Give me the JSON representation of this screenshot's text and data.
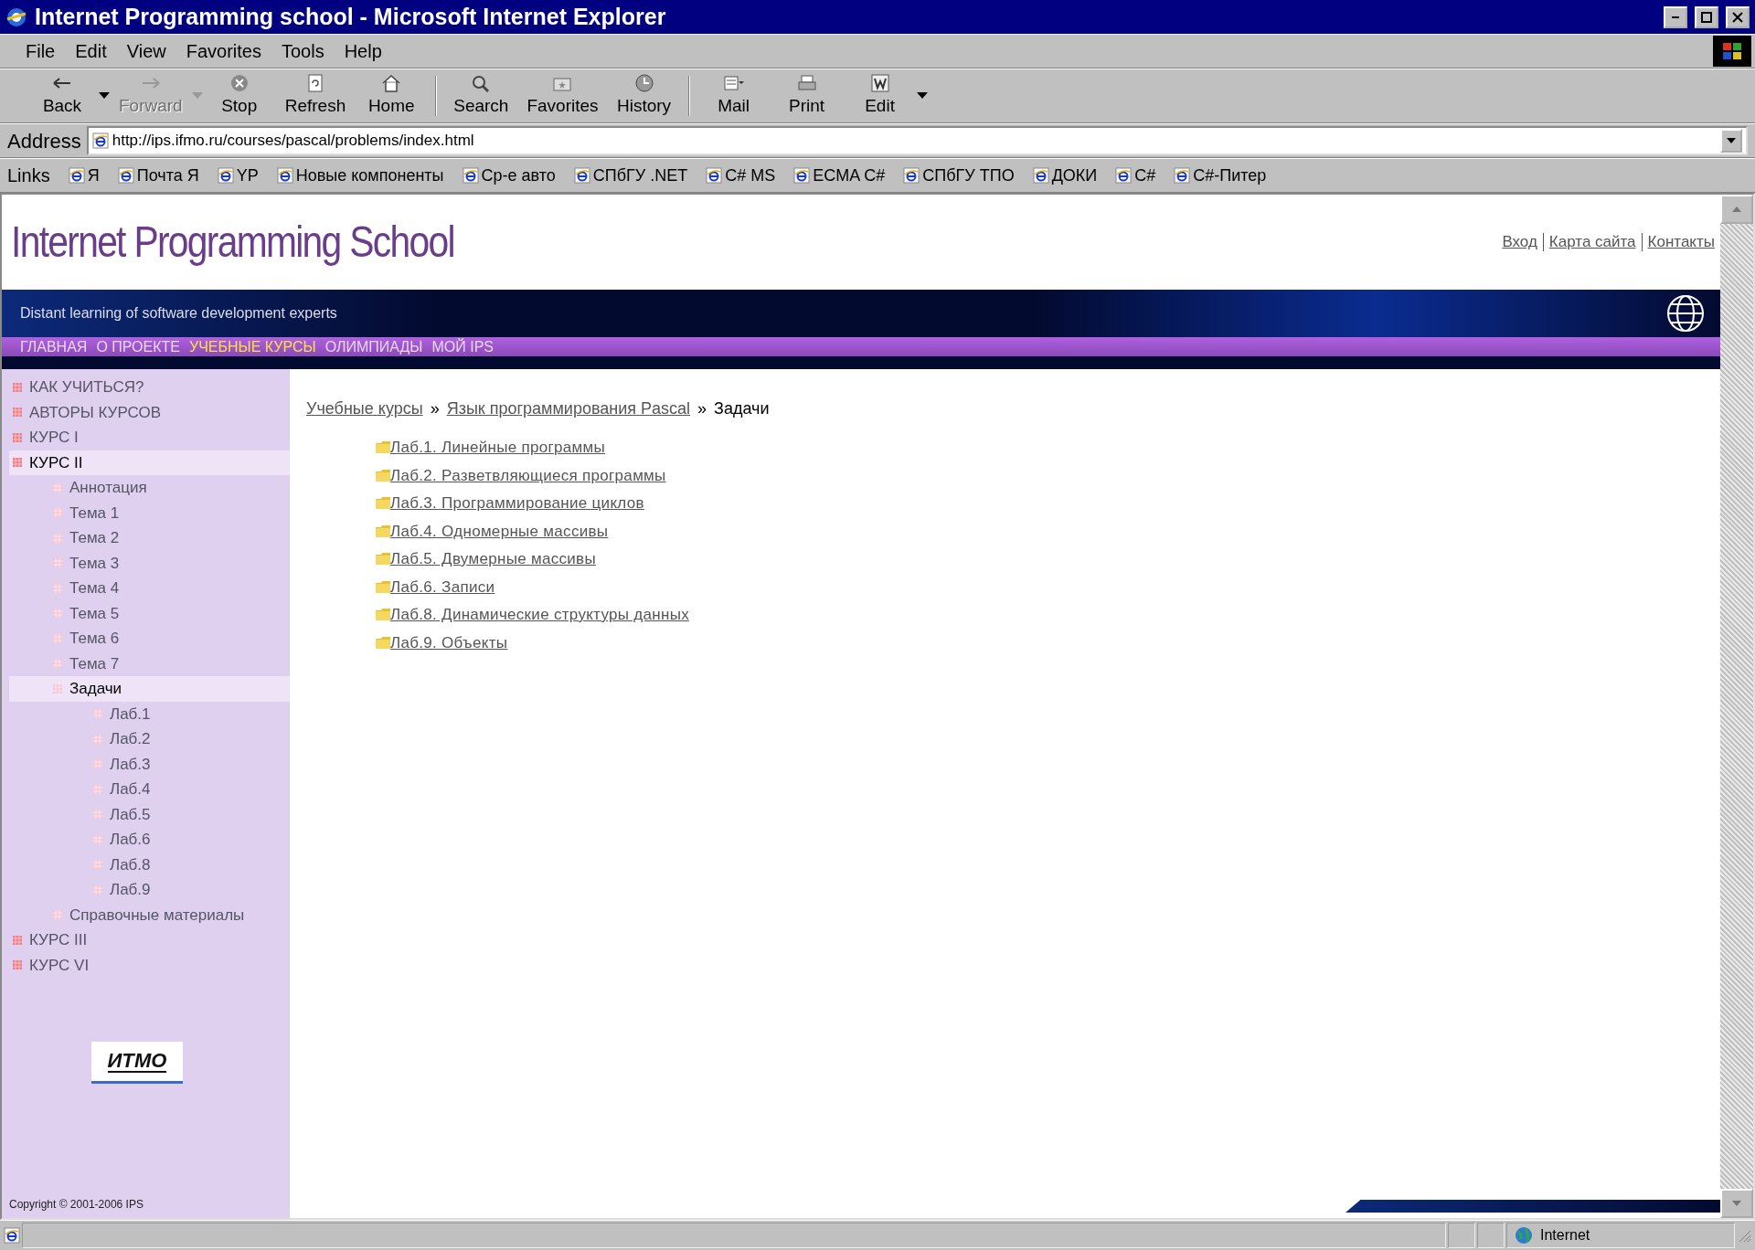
{
  "window": {
    "title": "Internet Programming school - Microsoft Internet Explorer"
  },
  "menu_bar": [
    "File",
    "Edit",
    "View",
    "Favorites",
    "Tools",
    "Help"
  ],
  "toolbar": [
    {
      "label": "Back",
      "kind": "back",
      "disabled": false,
      "dropdown": true
    },
    {
      "label": "Forward",
      "kind": "forward",
      "disabled": true,
      "dropdown": true
    },
    {
      "label": "Stop",
      "kind": "stop",
      "disabled": false,
      "dropdown": false
    },
    {
      "label": "Refresh",
      "kind": "refresh",
      "disabled": false,
      "dropdown": false
    },
    {
      "label": "Home",
      "kind": "home",
      "disabled": false,
      "dropdown": false
    },
    {
      "label": "Search",
      "kind": "search",
      "disabled": false,
      "dropdown": false
    },
    {
      "label": "Favorites",
      "kind": "favorites",
      "disabled": false,
      "dropdown": false
    },
    {
      "label": "History",
      "kind": "history",
      "disabled": false,
      "dropdown": false
    },
    {
      "label": "Mail",
      "kind": "mail",
      "disabled": false,
      "dropdown": false
    },
    {
      "label": "Print",
      "kind": "print",
      "disabled": false,
      "dropdown": false
    },
    {
      "label": "Edit",
      "kind": "edit",
      "disabled": false,
      "dropdown": false
    }
  ],
  "address_bar": {
    "label": "Address",
    "value": "http://ips.ifmo.ru/courses/pascal/problems/index.html"
  },
  "links_bar": {
    "label": "Links",
    "items": [
      "Я",
      "Почта Я",
      "YP",
      "Новые компоненты",
      "Ср-е авто",
      "СПбГУ .NET",
      "C# MS",
      "ECMA C#",
      "СПбГУ ТПО",
      "ДОКИ",
      "C#",
      "C#-Питер"
    ]
  },
  "page": {
    "site_title": "Internet Programming School",
    "header_links": [
      "Вход",
      "Карта сайта",
      "Контакты"
    ],
    "tagline": "Distant learning of software development experts",
    "nav": [
      {
        "label": "ГЛАВНАЯ",
        "selected": false
      },
      {
        "label": "О ПРОЕКТЕ",
        "selected": false
      },
      {
        "label": "УЧЕБНЫЕ КУРСЫ",
        "selected": true
      },
      {
        "label": "ОЛИМПИАДЫ",
        "selected": false
      },
      {
        "label": "МОЙ IPS",
        "selected": false
      }
    ],
    "sidebar": {
      "items": [
        {
          "label": "КАК УЧИТЬСЯ?",
          "selected": false
        },
        {
          "label": "АВТОРЫ КУРСОВ",
          "selected": false
        },
        {
          "label": "КУРС I",
          "selected": false
        },
        {
          "label": "КУРС II",
          "selected": true,
          "children": [
            {
              "label": "Аннотация",
              "selected": false
            },
            {
              "label": "Тема 1",
              "selected": false
            },
            {
              "label": "Тема 2",
              "selected": false
            },
            {
              "label": "Тема 3",
              "selected": false
            },
            {
              "label": "Тема 4",
              "selected": false
            },
            {
              "label": "Тема 5",
              "selected": false
            },
            {
              "label": "Тема 6",
              "selected": false
            },
            {
              "label": "Тема 7",
              "selected": false
            },
            {
              "label": "Задачи",
              "selected": true,
              "children": [
                {
                  "label": "Лаб.1",
                  "selected": false
                },
                {
                  "label": "Лаб.2",
                  "selected": false
                },
                {
                  "label": "Лаб.3",
                  "selected": false
                },
                {
                  "label": "Лаб.4",
                  "selected": false
                },
                {
                  "label": "Лаб.5",
                  "selected": false
                },
                {
                  "label": "Лаб.6",
                  "selected": false
                },
                {
                  "label": "Лаб.8",
                  "selected": false
                },
                {
                  "label": "Лаб.9",
                  "selected": false
                }
              ]
            },
            {
              "label": "Справочные материалы",
              "selected": false
            }
          ]
        },
        {
          "label": "КУРС III",
          "selected": false
        },
        {
          "label": "КУРС VI",
          "selected": false
        }
      ],
      "logo_text": "ИТМО",
      "copyright": "Copyright © 2001-2006 IPS"
    },
    "breadcrumb": [
      {
        "label": "Учебные курсы",
        "kind": "link"
      },
      {
        "label": "»",
        "kind": "separator"
      },
      {
        "label": "Язык программирования Pascal",
        "kind": "link"
      },
      {
        "label": "»",
        "kind": "separator"
      },
      {
        "label": "Задачи",
        "kind": "current"
      }
    ],
    "labs": [
      "Лаб.1. Линейные программы",
      "Лаб.2. Разветвляющиеся программы",
      "Лаб.3. Программирование циклов",
      "Лаб.4. Одномерные массивы",
      "Лаб.5. Двумерные массивы",
      "Лаб.6. Записи",
      "Лаб.8. Динамические структуры данных",
      "Лаб.9. Объекты"
    ]
  },
  "status_bar": {
    "zone": "Internet"
  }
}
